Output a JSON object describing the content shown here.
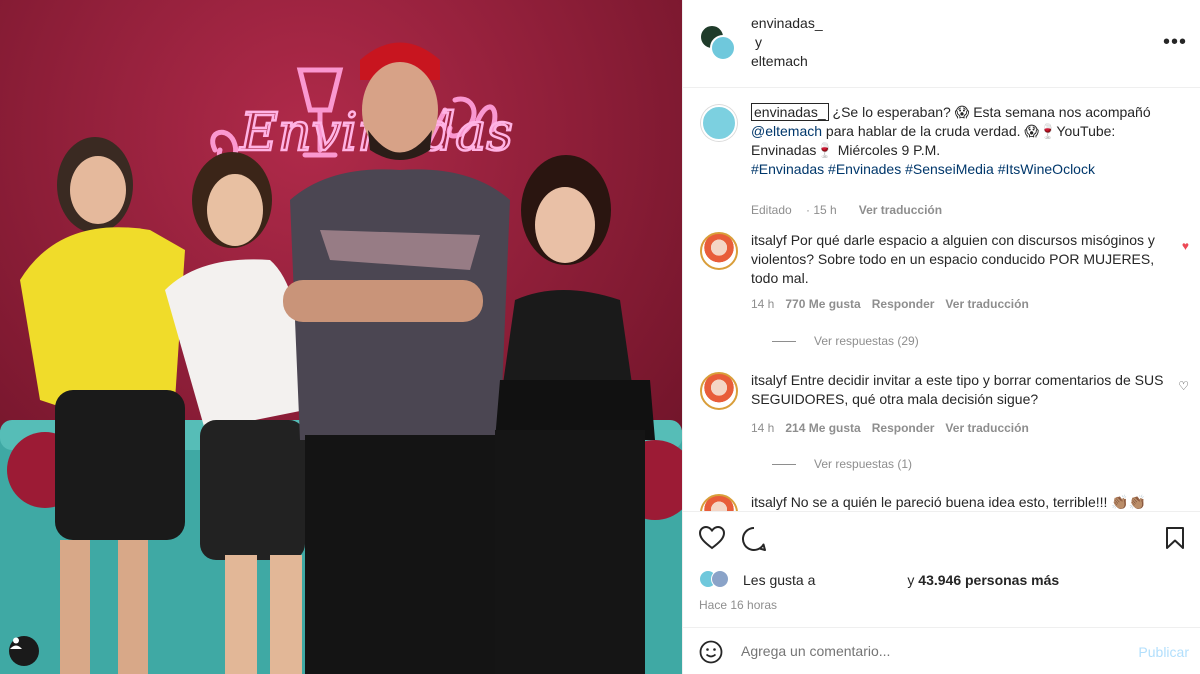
{
  "header": {
    "user1": "envinadas_",
    "connector": "y",
    "user2": "eltemach",
    "more_icon": "more-horizontal-icon"
  },
  "caption": {
    "username": "envinadas_",
    "text1": " ¿Se lo esperaban? 😱 Esta semana nos acompañó ",
    "mention": "@eltemach",
    "text2": " para hablar de la cruda verdad. 😱🍷YouTube: Envinadas🍷 Miércoles 9 P.M.",
    "hashtags": "#Envinadas #Envinades #SenseiMedia #ItsWineOclock",
    "edited": "Editado",
    "time": "15 h",
    "translate": "Ver traducción"
  },
  "comments": [
    {
      "username": "itsalyf",
      "text": "Por qué darle espacio a alguien con discursos misóginos y violentos? Sobre todo en un espacio conducido POR MUJERES, todo mal.",
      "time": "14 h",
      "likes": "770 Me gusta",
      "reply": "Responder",
      "translate": "Ver traducción",
      "replies": "Ver respuestas (29)",
      "liked": true
    },
    {
      "username": "itsalyf",
      "text": "Entre decidir invitar a este tipo y borrar comentarios de SUS SEGUIDORES, qué otra mala decisión sigue?",
      "time": "14 h",
      "likes": "214 Me gusta",
      "reply": "Responder",
      "translate": "Ver traducción",
      "replies": "Ver respuestas (1)",
      "liked": false
    },
    {
      "username": "itsalyf",
      "text": "No se a quién le pareció buena idea esto, terrible!!! 👏🏽👏🏽",
      "liked": false
    }
  ],
  "likes": {
    "prefix": "Les gusta a",
    "middle": "y",
    "count": "43.946 personas más"
  },
  "time_ago": "Hace 16 horas",
  "add_comment": {
    "placeholder": "Agrega un comentario...",
    "publish": "Publicar"
  },
  "photo": {
    "neon_sign": "Envinadas"
  },
  "colors": {
    "link": "#00376b",
    "meta": "#8e8e8e",
    "heart_red": "#ed4956",
    "publish_disabled": "#b2dffc"
  }
}
